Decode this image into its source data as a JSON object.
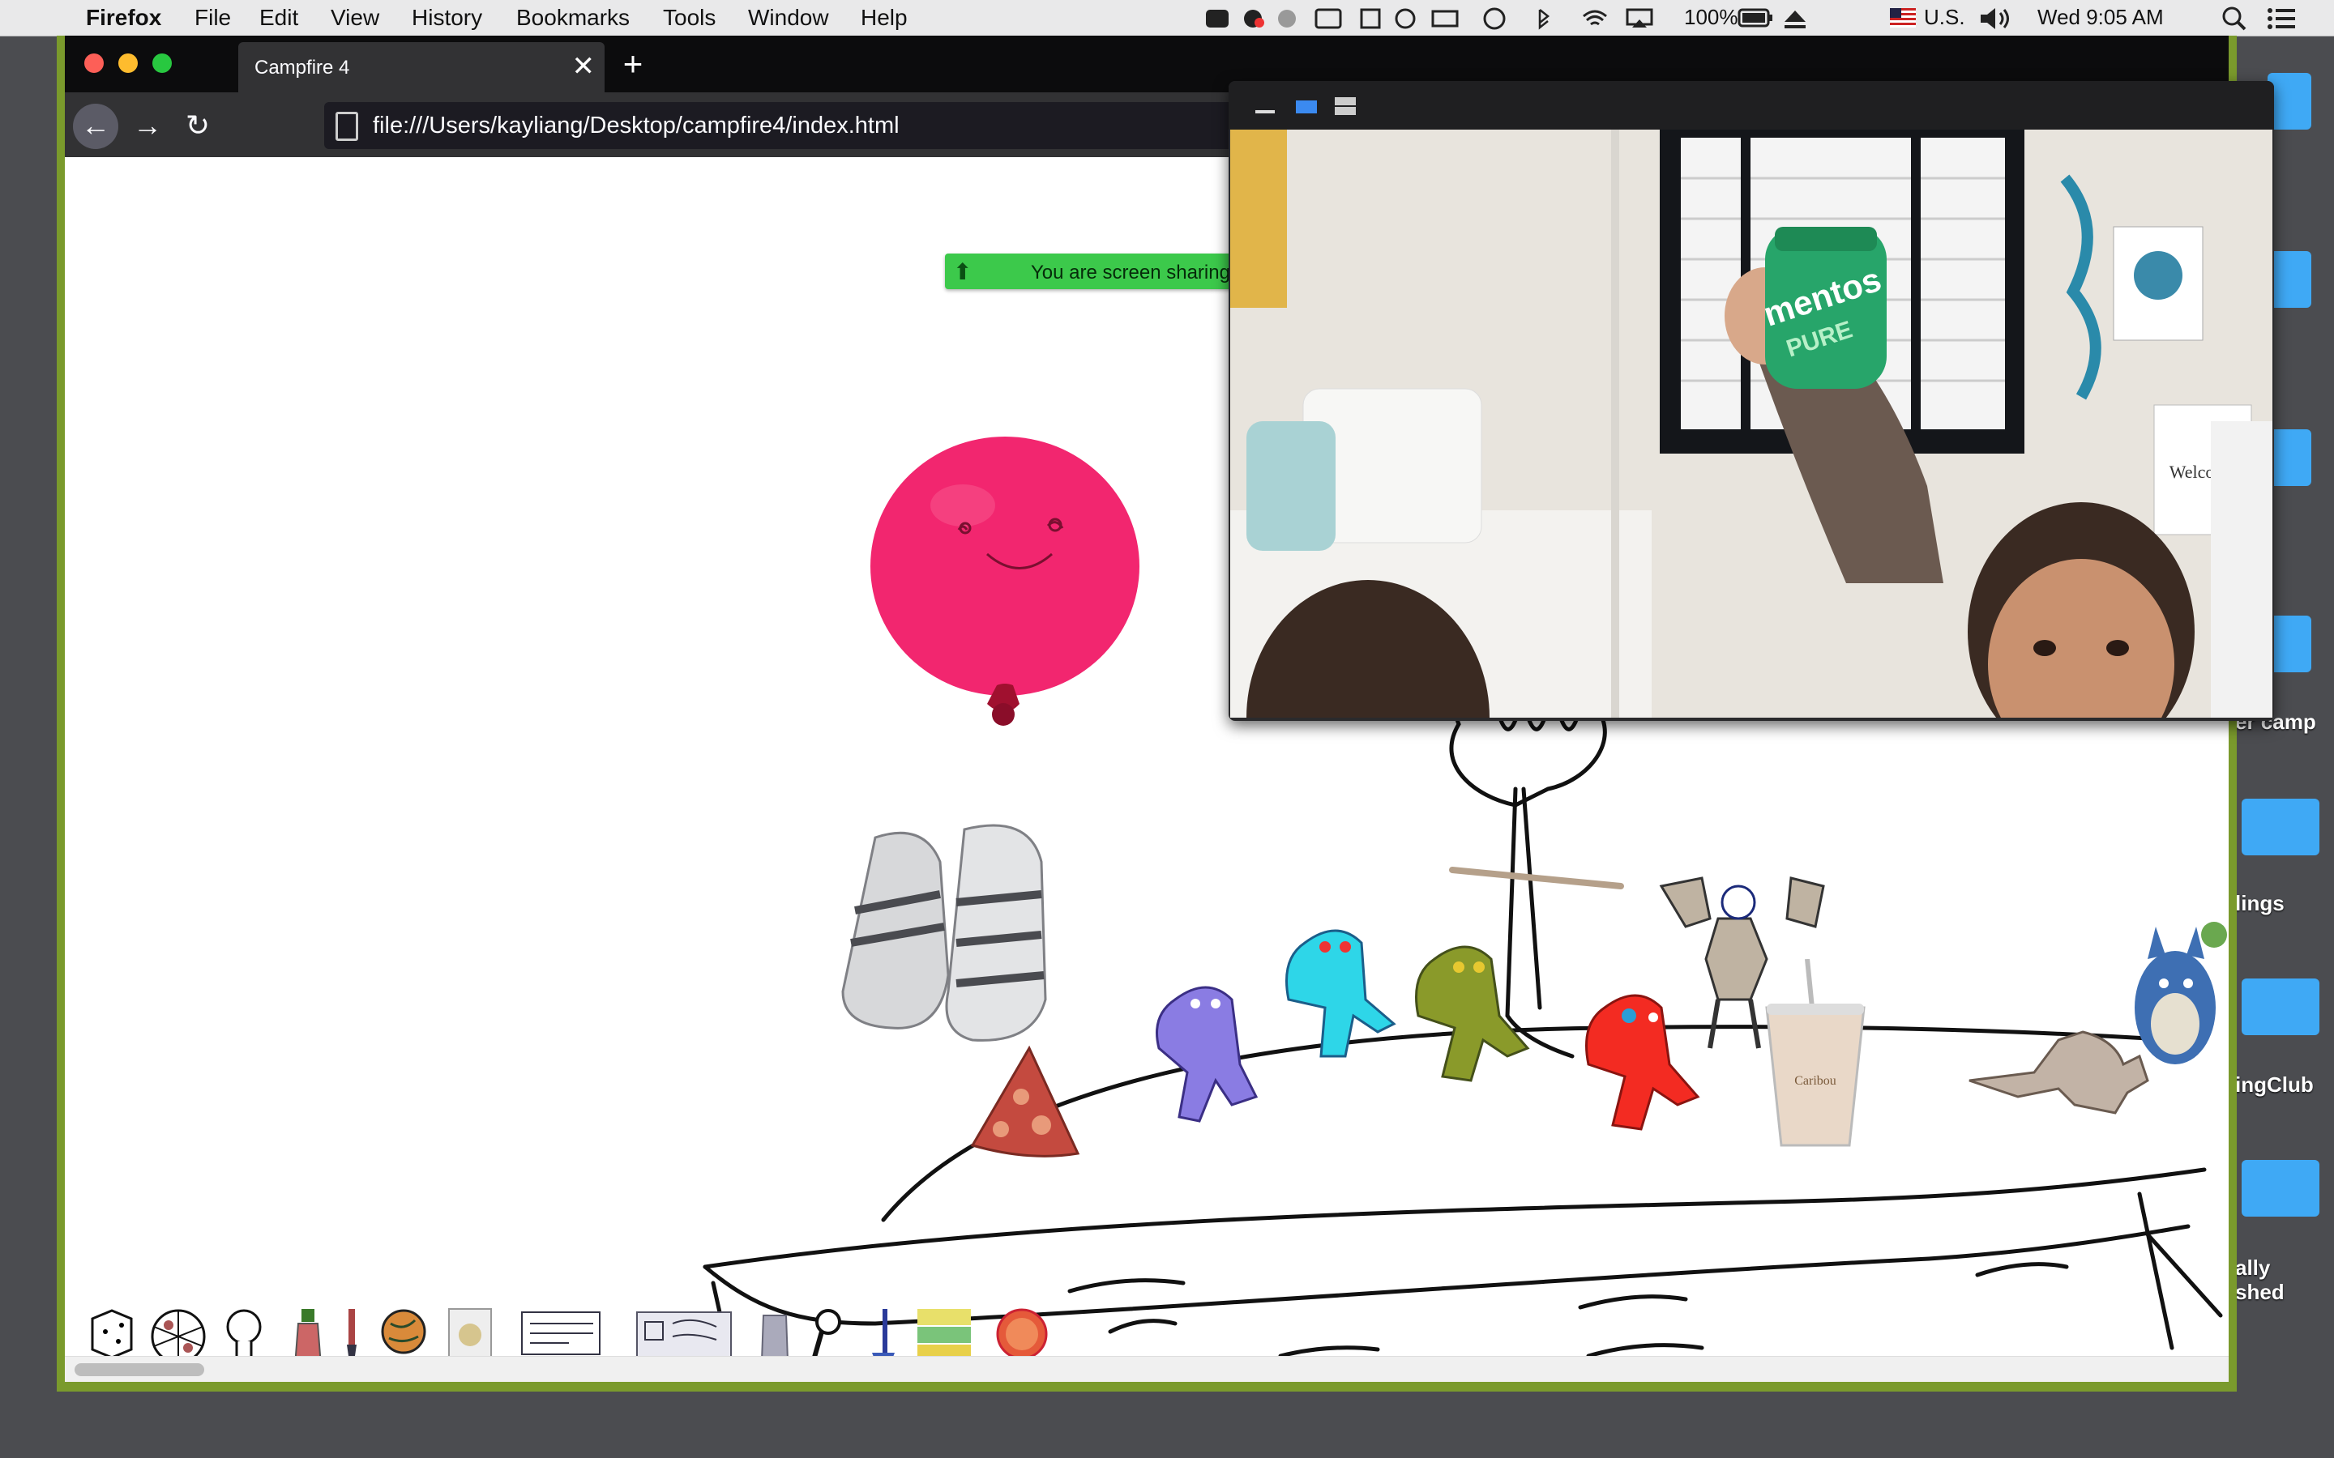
{
  "menubar": {
    "app_name": "Firefox",
    "menus": [
      "File",
      "Edit",
      "View",
      "History",
      "Bookmarks",
      "Tools",
      "Window",
      "Help"
    ],
    "battery": "100%",
    "input_source": "U.S.",
    "clock": "Wed 9:05 AM"
  },
  "desktop": {
    "labels": [
      "er camp",
      "lings",
      "ingClub",
      "ally",
      "shed"
    ]
  },
  "browser": {
    "tab_title": "Campfire 4",
    "url": "file:///Users/kayliang/Desktop/campfire4/index.html"
  },
  "screen_share": {
    "text": "You are screen sharing"
  },
  "video_call": {
    "product_text": "mentos",
    "product_subtext": "PURE",
    "wall_note": "Welcome"
  },
  "scene_text": {
    "cup_label": "Caribou"
  },
  "toolbar_items": [
    {
      "icon": "dice-icon"
    },
    {
      "icon": "spinner-wheel-icon"
    },
    {
      "icon": "lightbulb-icon"
    },
    {
      "icon": "bottle-icon"
    },
    {
      "icon": "paintbrush-icon"
    },
    {
      "icon": "globe-icon"
    },
    {
      "icon": "card-icon"
    },
    {
      "icon": "note-card-icon"
    },
    {
      "icon": "drawing-card-icon"
    },
    {
      "icon": "bag-icon"
    },
    {
      "icon": "magnifier-icon"
    },
    {
      "icon": "pen-icon"
    },
    {
      "icon": "sticky-notes-icon"
    },
    {
      "icon": "orange-slice-icon"
    }
  ],
  "colors": {
    "window_border": "#7a9a2c",
    "balloon": "#f2266f",
    "share_pill": "#3cc94b"
  }
}
